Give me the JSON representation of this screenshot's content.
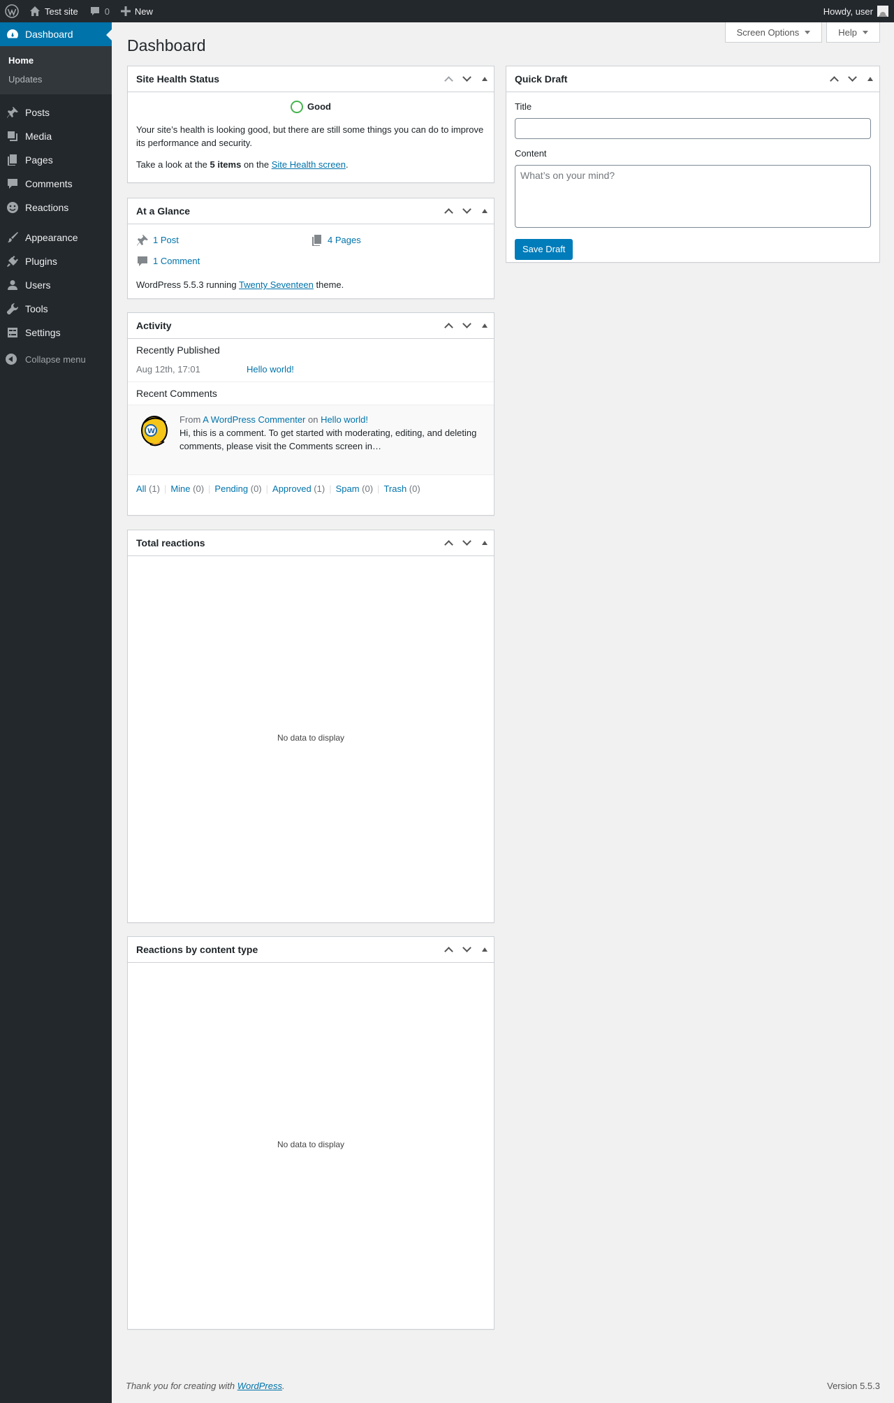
{
  "adminbar": {
    "site_name": "Test site",
    "comment_count": "0",
    "new_label": "New",
    "howdy": "Howdy, user"
  },
  "sidebar": {
    "dashboard": "Dashboard",
    "sub_home": "Home",
    "sub_updates": "Updates",
    "items": {
      "posts": "Posts",
      "media": "Media",
      "pages": "Pages",
      "comments": "Comments",
      "reactions": "Reactions",
      "appearance": "Appearance",
      "plugins": "Plugins",
      "users": "Users",
      "tools": "Tools",
      "settings": "Settings"
    },
    "collapse": "Collapse menu"
  },
  "screen_meta": {
    "screen_options": "Screen Options",
    "help": "Help"
  },
  "page_title": "Dashboard",
  "site_health": {
    "title": "Site Health Status",
    "status": "Good",
    "desc": "Your site’s health is looking good, but there are still some things you can do to improve its performance and security.",
    "take_look": "Take a look at the ",
    "items": "5 items",
    "on_the": " on the ",
    "link": "Site Health screen",
    "period": "."
  },
  "glance": {
    "title": "At a Glance",
    "posts": "1 Post",
    "pages": "4 Pages",
    "comments": "1 Comment",
    "running_prefix": "WordPress 5.5.3 running ",
    "theme": "Twenty Seventeen",
    "running_suffix": " theme."
  },
  "activity": {
    "title": "Activity",
    "recently_published": "Recently Published",
    "post_date": "Aug 12th, 17:01",
    "post_title": "Hello world!",
    "recent_comments": "Recent Comments",
    "from": "From ",
    "commenter": "A WordPress Commenter",
    "on": " on ",
    "comment_post": "Hello world!",
    "comment_text": "Hi, this is a comment. To get started with moderating, editing, and deleting comments, please visit the Comments screen in…",
    "filters": {
      "all": "All",
      "all_count": " (1)",
      "mine": "Mine",
      "mine_count": " (0)",
      "pending": "Pending",
      "pending_count": " (0)",
      "approved": "Approved",
      "approved_count": " (1)",
      "spam": "Spam",
      "spam_count": " (0)",
      "trash": "Trash",
      "trash_count": " (0)"
    }
  },
  "total_reactions": {
    "title": "Total reactions",
    "empty": "No data to display"
  },
  "reactions_by_type": {
    "title": "Reactions by content type",
    "empty": "No data to display"
  },
  "quick_draft": {
    "title": "Quick Draft",
    "title_label": "Title",
    "title_value": "",
    "content_label": "Content",
    "content_placeholder": "What’s on your mind?",
    "save": "Save Draft"
  },
  "footer": {
    "thanks": "Thank you for creating with ",
    "wp_link": "WordPress",
    "period": ".",
    "version": "Version 5.5.3"
  },
  "colors": {
    "adminbar_bg": "#23282d",
    "accent": "#0073aa",
    "button": "#007cba",
    "health_good": "#46b450"
  }
}
